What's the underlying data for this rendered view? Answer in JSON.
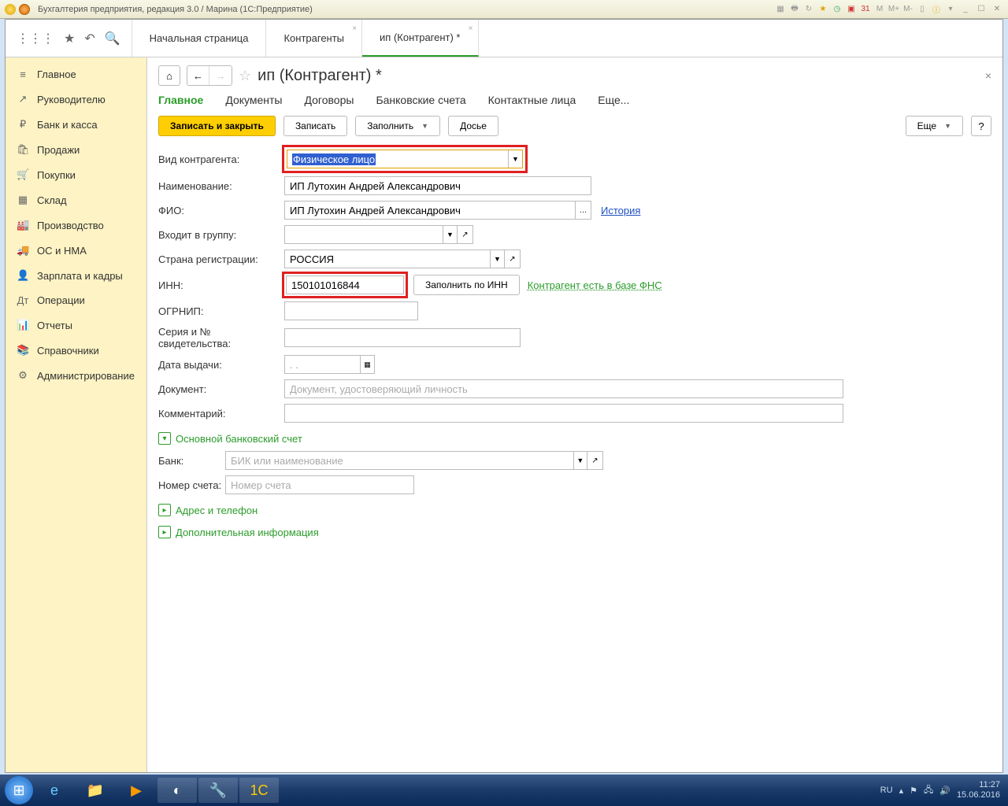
{
  "window": {
    "title": "Бухгалтерия предприятия, редакция 3.0 / Марина  (1С:Предприятие)"
  },
  "toptabs": {
    "home": "Начальная страница",
    "contragents": "Контрагенты",
    "current": "ип (Контрагент) *"
  },
  "sidebar": {
    "items": [
      {
        "icon": "≡",
        "label": "Главное"
      },
      {
        "icon": "↗",
        "label": "Руководителю"
      },
      {
        "icon": "₽",
        "label": "Банк и касса"
      },
      {
        "icon": "🛍",
        "label": "Продажи"
      },
      {
        "icon": "🛒",
        "label": "Покупки"
      },
      {
        "icon": "▦",
        "label": "Склад"
      },
      {
        "icon": "🏭",
        "label": "Производство"
      },
      {
        "icon": "🚚",
        "label": "ОС и НМА"
      },
      {
        "icon": "👤",
        "label": "Зарплата и кадры"
      },
      {
        "icon": "Дт",
        "label": "Операции"
      },
      {
        "icon": "📊",
        "label": "Отчеты"
      },
      {
        "icon": "📚",
        "label": "Справочники"
      },
      {
        "icon": "⚙",
        "label": "Администрирование"
      }
    ]
  },
  "page": {
    "title": "ип (Контрагент) *",
    "subtabs": {
      "main": "Главное",
      "docs": "Документы",
      "contracts": "Договоры",
      "bank": "Банковские счета",
      "contacts": "Контактные лица",
      "more": "Еще..."
    },
    "actions": {
      "save_close": "Записать и закрыть",
      "save": "Записать",
      "fill": "Заполнить",
      "dossier": "Досье",
      "more": "Еще",
      "help": "?"
    },
    "form": {
      "type_label": "Вид контрагента:",
      "type_value": "Физическое лицо",
      "name_label": "Наименование:",
      "name_value": "ИП Лутохин Андрей Александрович",
      "fio_label": "ФИО:",
      "fio_value": "ИП Лутохин Андрей Александрович",
      "history": "История",
      "group_label": "Входит в группу:",
      "group_value": "",
      "country_label": "Страна регистрации:",
      "country_value": "РОССИЯ",
      "inn_label": "ИНН:",
      "inn_value": "150101016844",
      "fill_by_inn": "Заполнить по ИНН",
      "fns_link": "Контрагент есть в базе ФНС",
      "ogrnip_label": "ОГРНИП:",
      "ogrnip_value": "",
      "cert_label": "Серия и № свидетельства:",
      "cert_value": "",
      "issue_date_label": "Дата выдачи:",
      "issue_date_value": " .  .    ",
      "doc_label": "Документ:",
      "doc_placeholder": "Документ, удостоверяющий личность",
      "comment_label": "Комментарий:",
      "comment_value": "",
      "section_bank": "Основной банковский счет",
      "bank_label": "Банк:",
      "bank_placeholder": "БИК или наименование",
      "acct_label": "Номер счета:",
      "acct_placeholder": "Номер счета",
      "section_addr": "Адрес и телефон",
      "section_extra": "Дополнительная информация"
    }
  },
  "taskbar": {
    "lang": "RU",
    "time": "11:27",
    "date": "15.06.2016"
  }
}
